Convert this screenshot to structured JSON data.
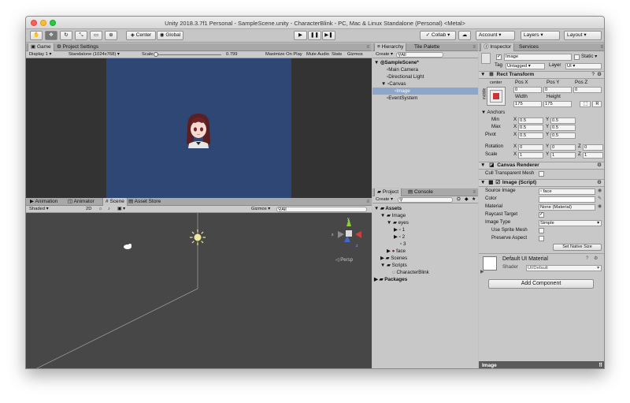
{
  "window": {
    "title": "Unity 2018.3.7f1 Personal - SampleScene.unity - CharacterBlink - PC, Mac & Linux Standalone (Personal) <Metal>"
  },
  "toolbar": {
    "center_label": "Center",
    "global_label": "Global",
    "collab_label": "Collab ▾",
    "account_label": "Account",
    "layers_label": "Layers",
    "layout_label": "Layout"
  },
  "game": {
    "tab_game": "Game",
    "tab_project_settings": "Project Settings",
    "display": "Display 1",
    "resolution": "Standalone (1024x768)",
    "scale_label": "Scale",
    "scale_value": "0.799",
    "maximize": "Maximize On Play",
    "mute": "Mute Audio",
    "stats": "Stats",
    "gizmos": "Gizmos",
    "background_color": "#2f4775"
  },
  "scene": {
    "tab_animation": "Animation",
    "tab_animator": "Animator",
    "tab_scene": "Scene",
    "tab_asset_store": "Asset Store",
    "shading": "Shaded",
    "mode_2d": "2D",
    "gizmos": "Gizmos",
    "search_all": "All",
    "persp": "Persp"
  },
  "hierarchy": {
    "tab": "Hierarchy",
    "tab2": "Tile Palette",
    "create": "Create",
    "search": "All",
    "items": [
      "SampleScene*",
      "Main Camera",
      "Directional Light",
      "Canvas",
      "Image",
      "EventSystem"
    ]
  },
  "project": {
    "tab": "Project",
    "tab2": "Console",
    "create": "Create",
    "items": [
      "Assets",
      "Image",
      "eyes",
      "1",
      "2",
      "3",
      "face",
      "Scenes",
      "Scripts",
      "CharacterBlink",
      "Packages"
    ]
  },
  "inspector": {
    "tab": "Inspector",
    "tab2": "Services",
    "object_name": "Image",
    "static_label": "Static",
    "tag_label": "Tag",
    "tag_value": "Untagged",
    "layer_label": "Layer",
    "layer_value": "UI",
    "rect_transform": "Rect Transform",
    "anchor_h": "center",
    "anchor_v": "middle",
    "pos_x_label": "Pos X",
    "pos_y_label": "Pos Y",
    "pos_z_label": "Pos Z",
    "pos_x": "0",
    "pos_y": "0",
    "pos_z": "0",
    "width_label": "Width",
    "height_label": "Height",
    "width": "175",
    "height": "175",
    "anchors_label": "Anchors",
    "min_label": "Min",
    "max_label": "Max",
    "pivot_label": "Pivot",
    "min_x": "0.5",
    "min_y": "0.5",
    "max_x": "0.5",
    "max_y": "0.5",
    "pivot_x": "0.5",
    "pivot_y": "0.5",
    "rotation_label": "Rotation",
    "scale_label": "Scale",
    "rot_x": "0",
    "rot_y": "0",
    "rot_z": "0",
    "scale_x": "1",
    "scale_y": "1",
    "scale_z": "1",
    "canvas_renderer": "Canvas Renderer",
    "cull_label": "Cull Transparent Mesh",
    "image_script": "Image (Script)",
    "source_image_label": "Source Image",
    "source_image": "face",
    "color_label": "Color",
    "material_label": "Material",
    "material_value": "None (Material)",
    "raycast_label": "Raycast Target",
    "image_type_label": "Image Type",
    "image_type": "Simple",
    "use_sprite_mesh": "Use Sprite Mesh",
    "preserve_aspect": "Preserve Aspect",
    "set_native_size": "Set Native Size",
    "material_name": "Default UI Material",
    "shader_label": "Shader",
    "shader_value": "UI/Default",
    "add_component": "Add Component",
    "preview_label": "Image",
    "axes_xyz": [
      "X",
      "Y",
      "Z"
    ]
  },
  "colors": {
    "accent_selection": "#3d80df",
    "hierarchy_selected": "#8da6c9"
  }
}
